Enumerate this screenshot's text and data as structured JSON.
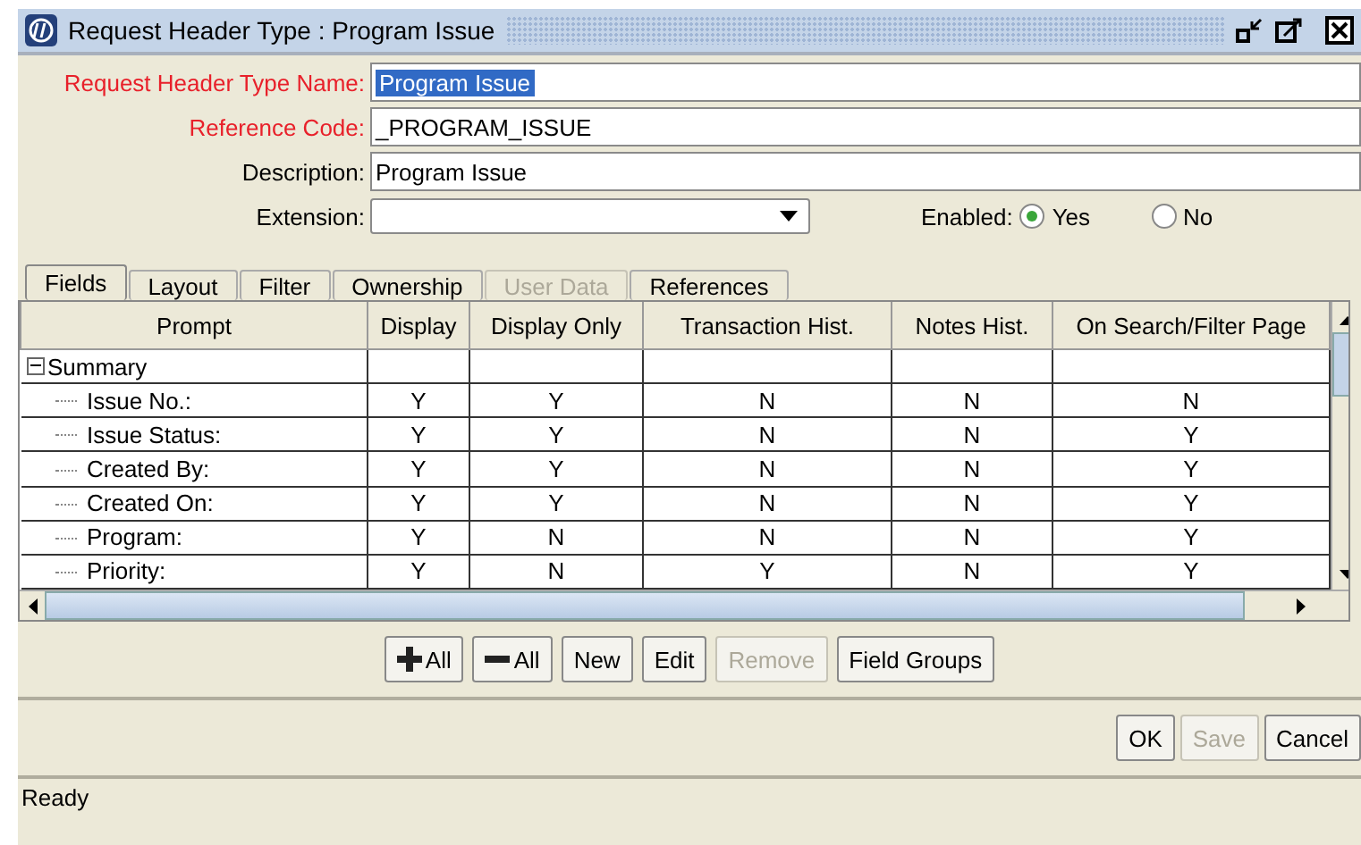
{
  "window": {
    "title": "Request Header Type : Program Issue"
  },
  "form": {
    "name": {
      "label": "Request Header Type Name:",
      "value": "Program Issue",
      "required": true
    },
    "reference_code": {
      "label": "Reference Code:",
      "value": "_PROGRAM_ISSUE",
      "required": true
    },
    "description": {
      "label": "Description:",
      "value": "Program Issue",
      "required": false
    },
    "extension": {
      "label": "Extension:"
    },
    "enabled": {
      "label": "Enabled:",
      "options": [
        {
          "label": "Yes",
          "selected": true
        },
        {
          "label": "No",
          "selected": false
        }
      ]
    }
  },
  "tabs": [
    {
      "label": "Fields",
      "selected": true,
      "disabled": false
    },
    {
      "label": "Layout",
      "selected": false,
      "disabled": false
    },
    {
      "label": "Filter",
      "selected": false,
      "disabled": false
    },
    {
      "label": "Ownership",
      "selected": false,
      "disabled": false
    },
    {
      "label": "User Data",
      "selected": false,
      "disabled": true
    },
    {
      "label": "References",
      "selected": false,
      "disabled": false
    }
  ],
  "table": {
    "columns": [
      "Prompt",
      "Display",
      "Display Only",
      "Transaction Hist.",
      "Notes Hist.",
      "On Search/Filter Page"
    ],
    "rows": [
      {
        "prompt": "Summary",
        "expanded": true,
        "children": [
          {
            "prompt": "Issue No.:",
            "cells": [
              "Y",
              "Y",
              "N",
              "N",
              "N"
            ]
          },
          {
            "prompt": "Issue Status:",
            "cells": [
              "Y",
              "Y",
              "N",
              "N",
              "Y"
            ]
          },
          {
            "prompt": "Created By:",
            "cells": [
              "Y",
              "Y",
              "N",
              "N",
              "Y"
            ]
          },
          {
            "prompt": "Created On:",
            "cells": [
              "Y",
              "Y",
              "N",
              "N",
              "Y"
            ]
          },
          {
            "prompt": "Program:",
            "cells": [
              "Y",
              "N",
              "N",
              "N",
              "Y"
            ]
          },
          {
            "prompt": "Priority:",
            "cells": [
              "Y",
              "N",
              "Y",
              "N",
              "Y"
            ]
          }
        ]
      }
    ]
  },
  "table_buttons": [
    {
      "label": "All",
      "kind": "expand",
      "disabled": false
    },
    {
      "label": "All",
      "kind": "collapse",
      "disabled": false
    },
    {
      "label": "New",
      "kind": "text",
      "disabled": false
    },
    {
      "label": "Edit",
      "kind": "text",
      "disabled": false
    },
    {
      "label": "Remove",
      "kind": "text",
      "disabled": true
    },
    {
      "label": "Field Groups",
      "kind": "text",
      "disabled": false
    }
  ],
  "dialog_buttons": [
    {
      "label": "OK",
      "disabled": false
    },
    {
      "label": "Save",
      "disabled": true
    },
    {
      "label": "Cancel",
      "disabled": false
    }
  ],
  "status_bar": "Ready"
}
